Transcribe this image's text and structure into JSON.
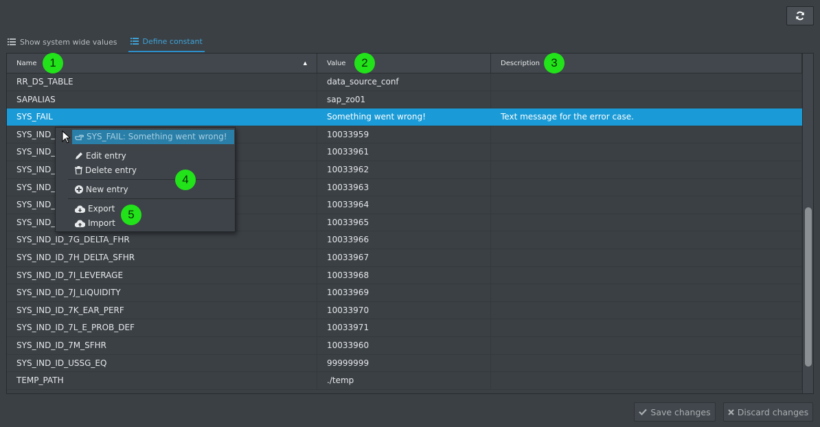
{
  "toolbar": {
    "refresh_icon": "refresh-icon"
  },
  "tabs": [
    {
      "label": "Show system wide values",
      "icon": "list-icon",
      "active": false
    },
    {
      "label": "Define constant",
      "icon": "list-icon",
      "active": true
    }
  ],
  "table": {
    "columns": [
      "Name",
      "Value",
      "Description"
    ],
    "rows": [
      {
        "name": "RR_DS_TABLE",
        "value": "data_source_conf",
        "description": ""
      },
      {
        "name": "SAPALIAS",
        "value": "sap_zo01",
        "description": ""
      },
      {
        "name": "SYS_FAIL",
        "value": "Something went wrong!",
        "description": "Text message for the error case."
      },
      {
        "name": "SYS_IND_ID",
        "value": "10033959",
        "description": ""
      },
      {
        "name": "SYS_IND_ID",
        "value": "10033961",
        "description": ""
      },
      {
        "name": "SYS_IND_ID",
        "value": "10033962",
        "description": ""
      },
      {
        "name": "SYS_IND_ID",
        "value": "10033963",
        "description": ""
      },
      {
        "name": "SYS_IND_ID",
        "value": "10033964",
        "description": ""
      },
      {
        "name": "SYS_IND_ID",
        "value": "10033965",
        "description": ""
      },
      {
        "name": "SYS_IND_ID_7G_DELTA_FHR",
        "value": "10033966",
        "description": ""
      },
      {
        "name": "SYS_IND_ID_7H_DELTA_SFHR",
        "value": "10033967",
        "description": ""
      },
      {
        "name": "SYS_IND_ID_7I_LEVERAGE",
        "value": "10033968",
        "description": ""
      },
      {
        "name": "SYS_IND_ID_7J_LIQUIDITY",
        "value": "10033969",
        "description": ""
      },
      {
        "name": "SYS_IND_ID_7K_EAR_PERF",
        "value": "10033970",
        "description": ""
      },
      {
        "name": "SYS_IND_ID_7L_E_PROB_DEF",
        "value": "10033971",
        "description": ""
      },
      {
        "name": "SYS_IND_ID_7M_SFHR",
        "value": "10033960",
        "description": ""
      },
      {
        "name": "SYS_IND_ID_USSG_EQ",
        "value": "99999999",
        "description": ""
      },
      {
        "name": "TEMP_PATH",
        "value": "./temp",
        "description": ""
      }
    ]
  },
  "context_menu": {
    "title": "SYS_FAIL: Something went wrong!",
    "items": [
      {
        "label": "Edit entry",
        "icon": "pencil-icon"
      },
      {
        "label": "Delete entry",
        "icon": "trash-icon"
      },
      {
        "label": "New entry",
        "icon": "plus-circle-icon"
      },
      {
        "label": "Export",
        "icon": "cloud-download-icon"
      },
      {
        "label": "Import",
        "icon": "cloud-upload-icon"
      }
    ]
  },
  "annotations": [
    "1",
    "2",
    "3",
    "4",
    "5"
  ],
  "footer": {
    "save_label": "Save changes",
    "discard_label": "Discard changes"
  },
  "colors": {
    "background": "#3b4045",
    "selected_row": "#1a9bd7",
    "accent": "#3da3d8",
    "badge": "#22e21a"
  }
}
